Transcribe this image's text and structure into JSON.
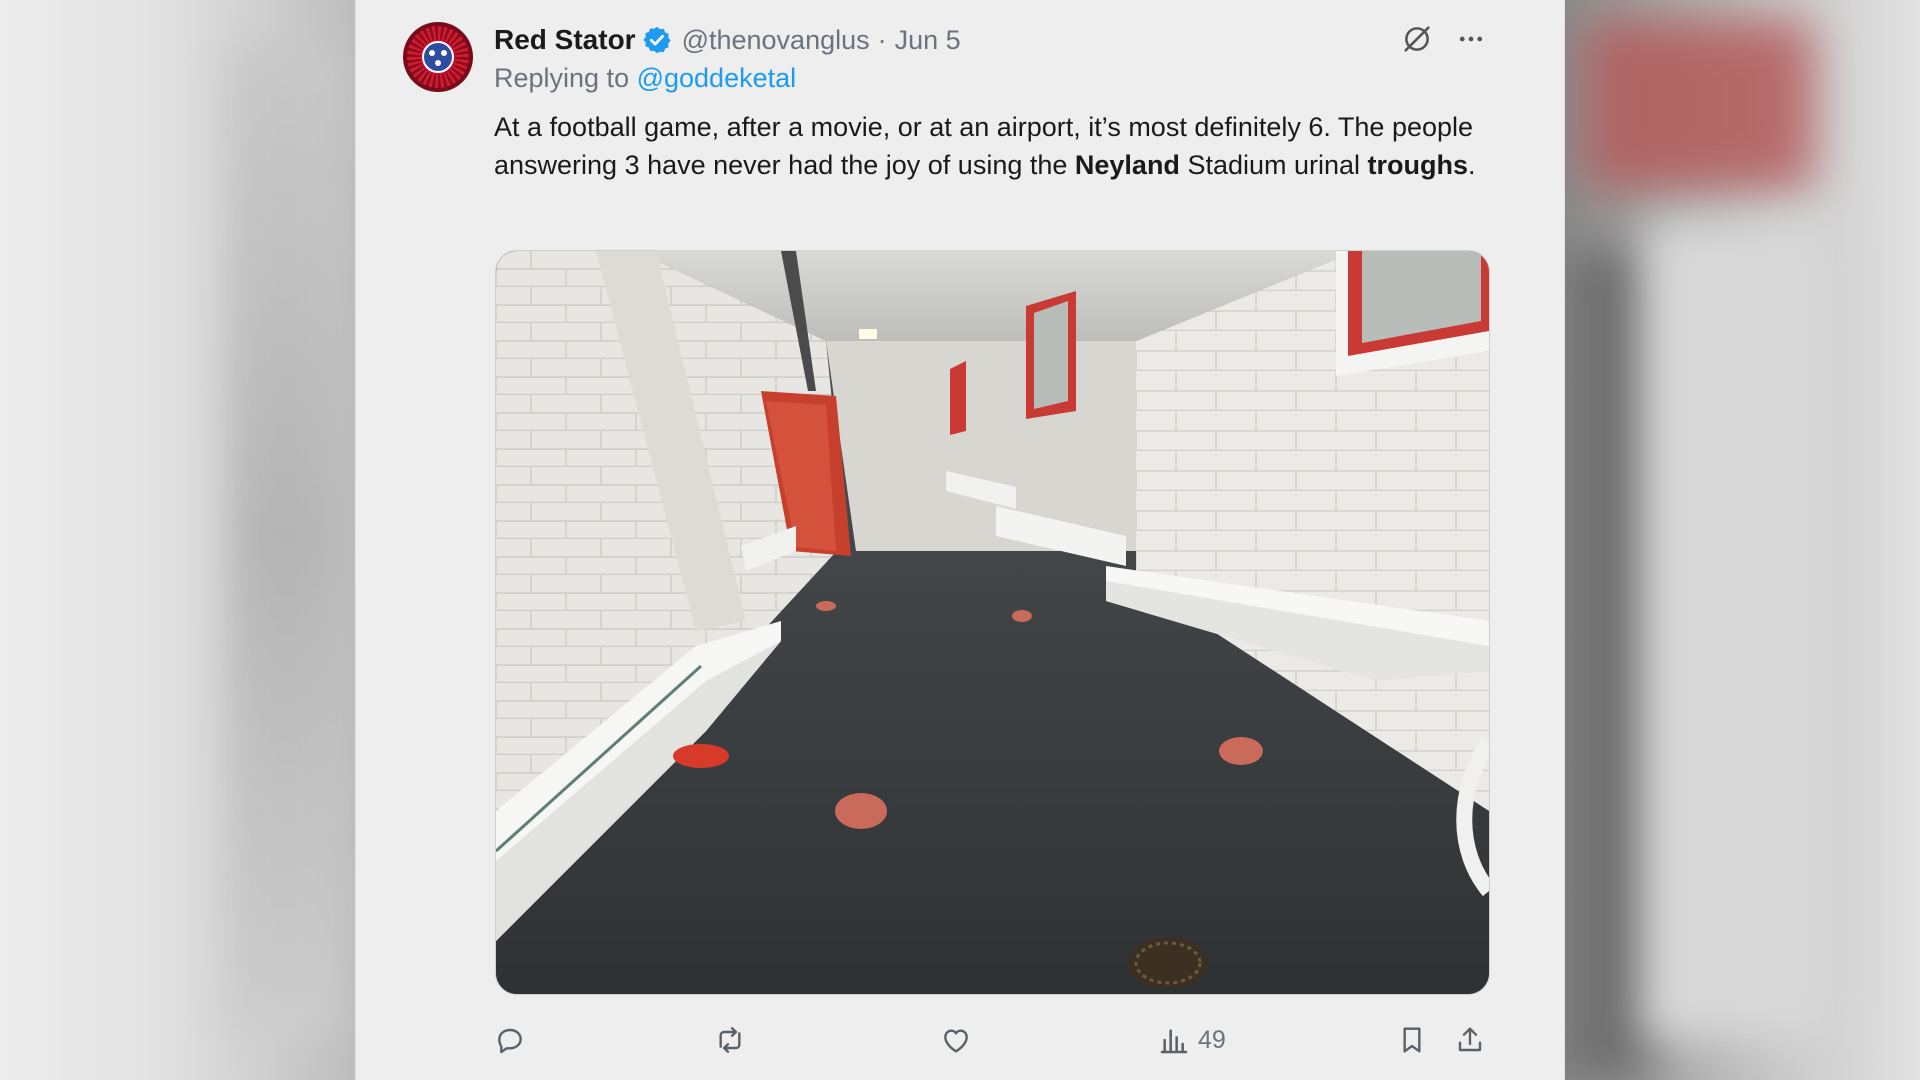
{
  "tweet": {
    "display_name": "Red Stator",
    "handle": "@thenovanglus",
    "separator": "·",
    "date": "Jun 5",
    "replying_prefix": "Replying to ",
    "replying_to": "@goddeketal",
    "body": {
      "part1": "At a football game, after a movie, or at an airport, it’s most definitely 6.  The people answering 3 have never had the joy of using the ",
      "bold1": "Neyland",
      "part2": " Stadium urinal ",
      "bold2": "troughs",
      "part3": "."
    },
    "media_alt": "Stadium restroom corridor with white urinal troughs and red doors",
    "actions": {
      "views_count": "49"
    }
  },
  "icons": {
    "verified": "verified-badge-icon",
    "grok": "grok-icon",
    "more": "more-icon",
    "reply": "reply-icon",
    "retweet": "retweet-icon",
    "like": "like-icon",
    "views": "views-icon",
    "bookmark": "bookmark-icon",
    "share": "share-icon"
  },
  "colors": {
    "link": "#1d9bf0",
    "verified": "#1d9bf0",
    "secondary_text": "#6b7280",
    "panel_bg": "#eeeeee"
  }
}
